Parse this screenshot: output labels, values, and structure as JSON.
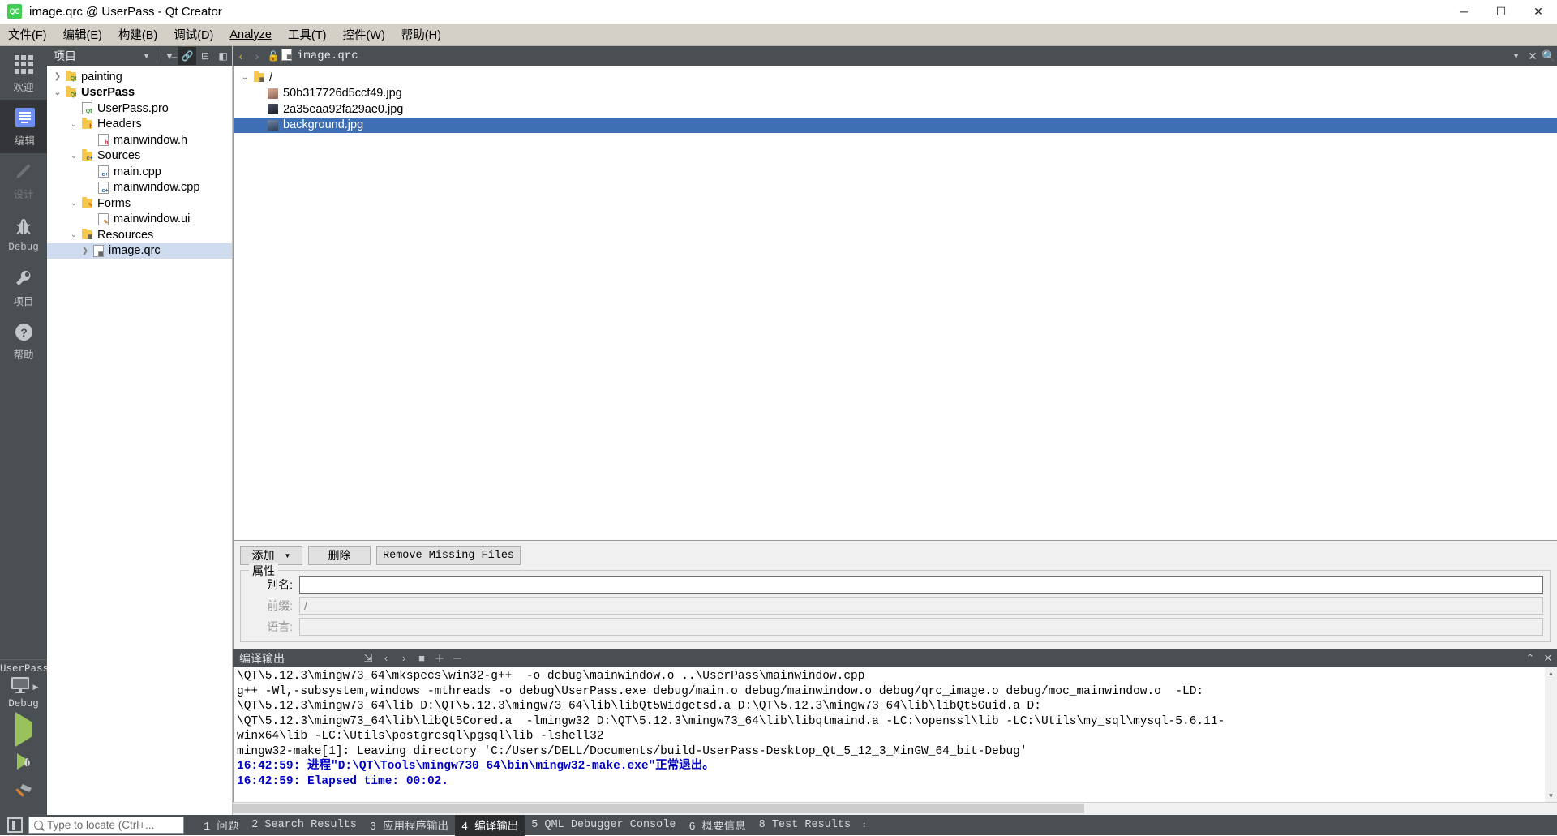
{
  "window": {
    "title": "image.qrc @ UserPass - Qt Creator",
    "app_icon_text": "QC",
    "minimize": "─",
    "maximize": "☐",
    "close": "✕"
  },
  "menubar": {
    "items": [
      {
        "label": "文件(F)",
        "mnemonic": "F"
      },
      {
        "label": "编辑(E)",
        "mnemonic": "E"
      },
      {
        "label": "构建(B)",
        "mnemonic": "B"
      },
      {
        "label": "调试(D)",
        "mnemonic": "D"
      },
      {
        "label": "Analyze",
        "mnemonic": "A"
      },
      {
        "label": "工具(T)",
        "mnemonic": "T"
      },
      {
        "label": "控件(W)",
        "mnemonic": "W"
      },
      {
        "label": "帮助(H)",
        "mnemonic": "H"
      }
    ]
  },
  "modebar": {
    "modes": [
      {
        "label": "欢迎",
        "icon": "grid-icon",
        "active": false,
        "disabled": false
      },
      {
        "label": "编辑",
        "icon": "editor-icon",
        "active": true,
        "disabled": false
      },
      {
        "label": "设计",
        "icon": "pencil-icon",
        "active": false,
        "disabled": true
      },
      {
        "label": "Debug",
        "icon": "bug-icon",
        "active": false,
        "disabled": false
      },
      {
        "label": "项目",
        "icon": "wrench-icon",
        "active": false,
        "disabled": false
      },
      {
        "label": "帮助",
        "icon": "question-icon",
        "active": false,
        "disabled": false
      }
    ],
    "kit": {
      "project": "UserPass",
      "config": "Debug",
      "monitor_icon": "monitor-icon"
    },
    "run_buttons": [
      {
        "name": "run-button",
        "icon": "play-icon"
      },
      {
        "name": "debug-button",
        "icon": "play-bug-icon"
      },
      {
        "name": "build-button",
        "icon": "hammer-icon"
      }
    ]
  },
  "project_pane": {
    "title": "项目",
    "toolbar": [
      {
        "name": "filter-button",
        "icon": "filter-icon",
        "active": false
      },
      {
        "name": "link-button",
        "icon": "link-icon",
        "active": true
      },
      {
        "name": "split-button",
        "icon": "split-icon",
        "active": false
      },
      {
        "name": "close-pane-button",
        "icon": "close-pane-icon",
        "active": false
      }
    ],
    "tree": [
      {
        "label": "painting",
        "indent": 0,
        "arrow": "collapsed",
        "icon": "qt-folder-icon",
        "bold": false,
        "selected": false
      },
      {
        "label": "UserPass",
        "indent": 0,
        "arrow": "expanded",
        "icon": "qt-folder-icon",
        "bold": true,
        "selected": false
      },
      {
        "label": "UserPass.pro",
        "indent": 1,
        "arrow": "none",
        "icon": "pro-file-icon",
        "bold": false,
        "selected": false
      },
      {
        "label": "Headers",
        "indent": 1,
        "arrow": "expanded",
        "icon": "h-folder-icon",
        "bold": false,
        "selected": false
      },
      {
        "label": "mainwindow.h",
        "indent": 2,
        "arrow": "none",
        "icon": "h-file-icon",
        "bold": false,
        "selected": false
      },
      {
        "label": "Sources",
        "indent": 1,
        "arrow": "expanded",
        "icon": "cpp-folder-icon",
        "bold": false,
        "selected": false
      },
      {
        "label": "main.cpp",
        "indent": 2,
        "arrow": "none",
        "icon": "cpp-file-icon",
        "bold": false,
        "selected": false
      },
      {
        "label": "mainwindow.cpp",
        "indent": 2,
        "arrow": "none",
        "icon": "cpp-file-icon",
        "bold": false,
        "selected": false
      },
      {
        "label": "Forms",
        "indent": 1,
        "arrow": "expanded",
        "icon": "ui-folder-icon",
        "bold": false,
        "selected": false
      },
      {
        "label": "mainwindow.ui",
        "indent": 2,
        "arrow": "none",
        "icon": "ui-file-icon",
        "bold": false,
        "selected": false
      },
      {
        "label": "Resources",
        "indent": 1,
        "arrow": "expanded",
        "icon": "qrc-folder-icon",
        "bold": false,
        "selected": false
      },
      {
        "label": "image.qrc",
        "indent": 2,
        "arrow": "collapsed",
        "icon": "qrc-file-icon",
        "bold": false,
        "selected": true
      }
    ]
  },
  "editor": {
    "tab": {
      "filename": "image.qrc",
      "back_arrow": "‹",
      "forward_arrow": "›",
      "lock_icon": "unlocked-icon",
      "dropdown_caret": "▼",
      "close_label": "✕",
      "split_icon": "split-editor-icon"
    },
    "qrc_tree": [
      {
        "label": "/",
        "indent": 0,
        "arrow": "expanded",
        "icon": "qrc-prefix-folder-icon",
        "selected": false,
        "color": "#f5c84c"
      },
      {
        "label": "50b317726d5ccf49.jpg",
        "indent": 1,
        "arrow": "none",
        "icon": "image-thumb-icon",
        "selected": false,
        "color": "#c49a86"
      },
      {
        "label": "2a35eaa92fa29ae0.jpg",
        "indent": 1,
        "arrow": "none",
        "icon": "image-thumb-icon",
        "selected": false,
        "color": "#2c2f3a"
      },
      {
        "label": "background.jpg",
        "indent": 1,
        "arrow": "none",
        "icon": "image-thumb-icon",
        "selected": true,
        "color": "#3e6fb5"
      }
    ],
    "buttons": {
      "add": "添加",
      "add_caret": "▼",
      "remove": "删除",
      "remove_missing": "Remove Missing Files"
    },
    "properties": {
      "group_title": "属性",
      "alias_label": "别名:",
      "alias_value": "",
      "prefix_label": "前缀:",
      "prefix_value": "/",
      "language_label": "语言:",
      "language_value": ""
    }
  },
  "output_pane": {
    "title": "编译输出",
    "toolbar": [
      {
        "name": "word-wrap-button",
        "icon": "wrap-icon"
      },
      {
        "name": "prev-item-button",
        "icon": "chevron-left-icon"
      },
      {
        "name": "next-item-button",
        "icon": "chevron-right-icon"
      },
      {
        "name": "stop-button",
        "icon": "stop-icon"
      },
      {
        "name": "zoom-in-button",
        "icon": "plus-icon"
      },
      {
        "name": "zoom-out-button",
        "icon": "minus-icon"
      }
    ],
    "maximize_icon": "chevron-up-icon",
    "close_icon": "close-icon",
    "lines": [
      {
        "text": "\\QT\\5.12.3\\mingw73_64\\mkspecs\\win32-g++  -o debug\\mainwindow.o ..\\UserPass\\mainwindow.cpp",
        "bold": false
      },
      {
        "text": "g++ -Wl,-subsystem,windows -mthreads -o debug\\UserPass.exe debug/main.o debug/mainwindow.o debug/qrc_image.o debug/moc_mainwindow.o  -LD:",
        "bold": false
      },
      {
        "text": "\\QT\\5.12.3\\mingw73_64\\lib D:\\QT\\5.12.3\\mingw73_64\\lib\\libQt5Widgetsd.a D:\\QT\\5.12.3\\mingw73_64\\lib\\libQt5Guid.a D:",
        "bold": false
      },
      {
        "text": "\\QT\\5.12.3\\mingw73_64\\lib\\libQt5Cored.a  -lmingw32 D:\\QT\\5.12.3\\mingw73_64\\lib\\libqtmaind.a -LC:\\openssl\\lib -LC:\\Utils\\my_sql\\mysql-5.6.11-",
        "bold": false
      },
      {
        "text": "winx64\\lib -LC:\\Utils\\postgresql\\pgsql\\lib -lshell32",
        "bold": false
      },
      {
        "text": "mingw32-make[1]: Leaving directory 'C:/Users/DELL/Documents/build-UserPass-Desktop_Qt_5_12_3_MinGW_64_bit-Debug'",
        "bold": false
      },
      {
        "text": "16:42:59: 进程\"D:\\QT\\Tools\\mingw730_64\\bin\\mingw32-make.exe\"正常退出。",
        "bold": true
      },
      {
        "text": "16:42:59: Elapsed time: 00:02.",
        "bold": true
      }
    ]
  },
  "statusbar": {
    "toggle_icon": "sidebar-toggle-icon",
    "locator_placeholder": "Type to locate (Ctrl+...",
    "search_icon": "search-icon",
    "items": [
      {
        "label": "1 问题",
        "active": false
      },
      {
        "label": "2 Search Results",
        "active": false
      },
      {
        "label": "3 应用程序输出",
        "active": false
      },
      {
        "label": "4 编译输出",
        "active": true
      },
      {
        "label": "5 QML Debugger Console",
        "active": false
      },
      {
        "label": "6 概要信息",
        "active": false
      },
      {
        "label": "8 Test Results",
        "active": false
      }
    ],
    "updown": "↕"
  },
  "colors": {
    "chrome_dark": "#4a4f53",
    "chrome_darker": "#2b2d2f",
    "menu_bg": "#d4d0c8",
    "selection_blue": "#3e6fb5",
    "tree_selection": "#cfdcf0",
    "qt_green": "#41cd52",
    "output_bold": "#0000c0",
    "run_green": "#9ac25a"
  }
}
